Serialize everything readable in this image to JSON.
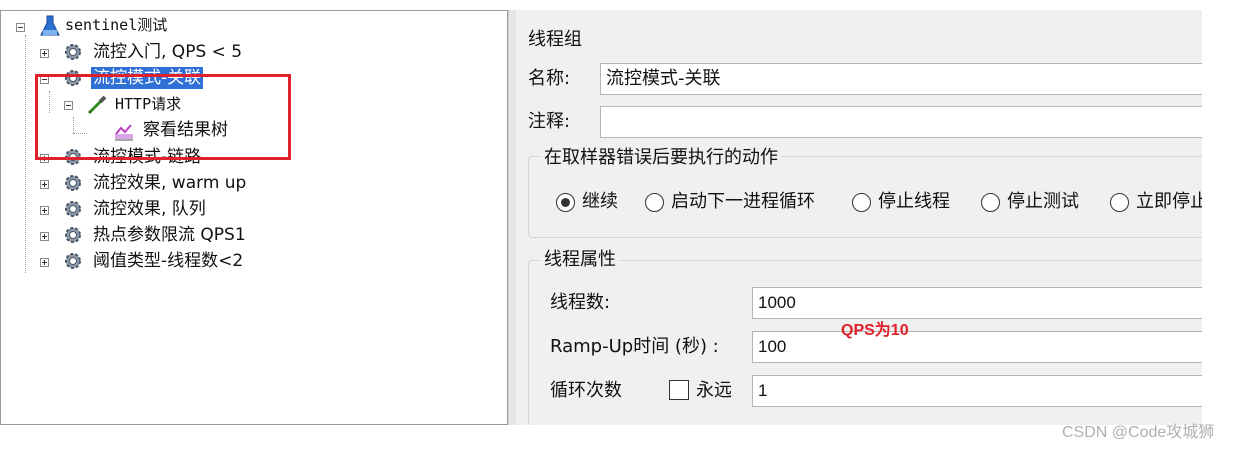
{
  "tree": {
    "root": {
      "label": "sentinel测试",
      "icon": "flask-icon"
    },
    "items": [
      {
        "label": "流控入门, QPS < 5",
        "icon": "gear-icon",
        "expanded": false
      },
      {
        "label": "流控模式-关联",
        "icon": "gear-icon",
        "expanded": true,
        "selected": true,
        "children": [
          {
            "label": "HTTP请求",
            "icon": "pipette-icon",
            "expanded": true,
            "children": [
              {
                "label": "察看结果树",
                "icon": "chart-icon"
              }
            ]
          }
        ]
      },
      {
        "label": "流控模式-链路",
        "icon": "gear-icon",
        "expanded": false
      },
      {
        "label": "流控效果, warm up",
        "icon": "gear-icon",
        "expanded": false
      },
      {
        "label": "流控效果, 队列",
        "icon": "gear-icon",
        "expanded": false
      },
      {
        "label": "热点参数限流 QPS1",
        "icon": "gear-icon",
        "expanded": false
      },
      {
        "label": "阈值类型-线程数<2",
        "icon": "gear-icon",
        "expanded": false
      }
    ]
  },
  "panel": {
    "title": "线程组",
    "name_label": "名称:",
    "name_value": "流控模式-关联",
    "comment_label": "注释:",
    "comment_value": "",
    "error_action": {
      "title": "在取样器错误后要执行的动作",
      "options": [
        "继续",
        "启动下一进程循环",
        "停止线程",
        "停止测试",
        "立即停止"
      ],
      "selected_index": 0
    },
    "thread_props": {
      "title": "线程属性",
      "threads_label": "线程数:",
      "threads_value": "1000",
      "rampup_label": "Ramp-Up时间 (秒) :",
      "rampup_value": "100",
      "loop_label": "循环次数",
      "forever_label": "永远",
      "forever_checked": false,
      "loop_value": "1"
    }
  },
  "annotation": {
    "text": "QPS为10",
    "color": "#e0202a"
  },
  "watermark": "CSDN @Code攻城狮",
  "colors": {
    "selection": "#2f6fd6",
    "highlight_box": "#e0202a",
    "panel_bg": "#f0f0f0"
  }
}
